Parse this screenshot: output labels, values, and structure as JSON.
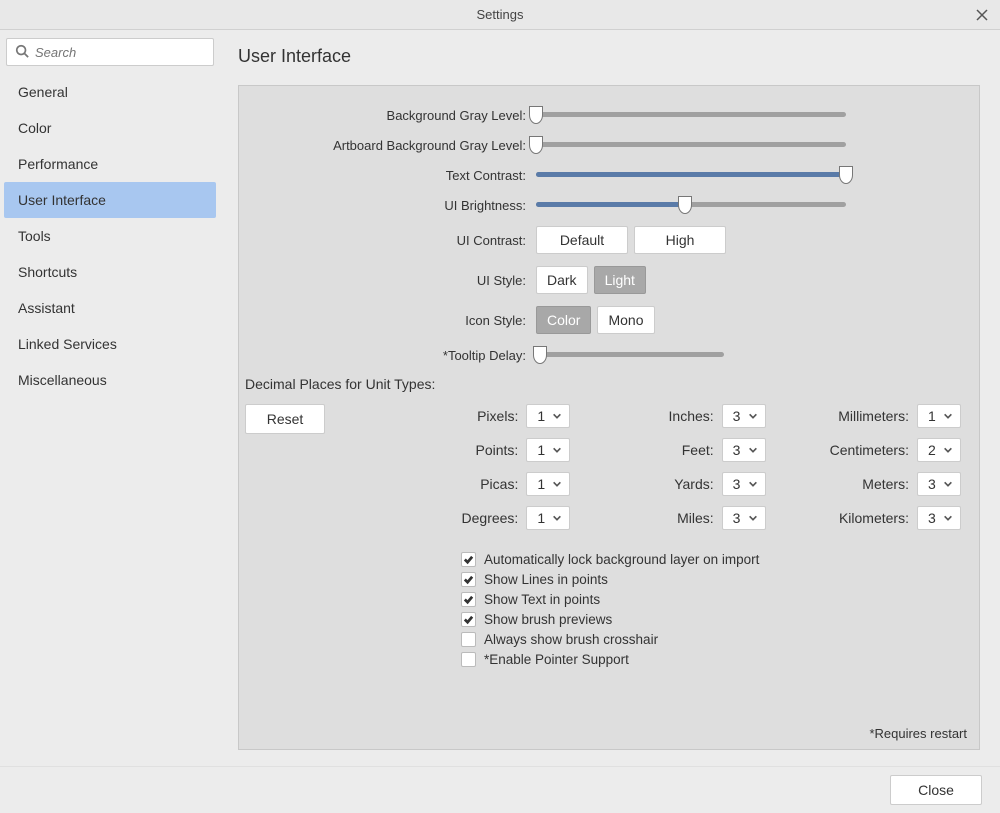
{
  "titlebar": {
    "title": "Settings"
  },
  "search": {
    "placeholder": "Search"
  },
  "sidebar": {
    "items": [
      {
        "label": "General"
      },
      {
        "label": "Color"
      },
      {
        "label": "Performance"
      },
      {
        "label": "User Interface"
      },
      {
        "label": "Tools"
      },
      {
        "label": "Shortcuts"
      },
      {
        "label": "Assistant"
      },
      {
        "label": "Linked Services"
      },
      {
        "label": "Miscellaneous"
      }
    ],
    "active_index": 3
  },
  "content": {
    "title": "User Interface",
    "sliders": {
      "bg_gray": {
        "label": "Background Gray Level:",
        "value_pct": 0
      },
      "artboard_bg_gray": {
        "label": "Artboard Background Gray Level:",
        "value_pct": 0
      },
      "text_contrast": {
        "label": "Text Contrast:",
        "value_pct": 100
      },
      "ui_brightness": {
        "label": "UI Brightness:",
        "value_pct": 48
      },
      "tooltip_delay": {
        "label": "*Tooltip Delay:",
        "value_pct": 2
      }
    },
    "ui_contrast": {
      "label": "UI Contrast:",
      "options": [
        "Default",
        "High"
      ],
      "selected_index": 0
    },
    "ui_style": {
      "label": "UI Style:",
      "options": [
        "Dark",
        "Light"
      ],
      "selected_index": 1
    },
    "icon_style": {
      "label": "Icon Style:",
      "options": [
        "Color",
        "Mono"
      ],
      "selected_index": 0
    },
    "decimal_section": "Decimal Places for Unit Types:",
    "reset": "Reset",
    "units": {
      "pixels": {
        "label": "Pixels:",
        "value": "1"
      },
      "points": {
        "label": "Points:",
        "value": "1"
      },
      "picas": {
        "label": "Picas:",
        "value": "1"
      },
      "degrees": {
        "label": "Degrees:",
        "value": "1"
      },
      "inches": {
        "label": "Inches:",
        "value": "3"
      },
      "feet": {
        "label": "Feet:",
        "value": "3"
      },
      "yards": {
        "label": "Yards:",
        "value": "3"
      },
      "miles": {
        "label": "Miles:",
        "value": "3"
      },
      "millimeters": {
        "label": "Millimeters:",
        "value": "1"
      },
      "centimeters": {
        "label": "Centimeters:",
        "value": "2"
      },
      "meters": {
        "label": "Meters:",
        "value": "3"
      },
      "kilometers": {
        "label": "Kilometers:",
        "value": "3"
      }
    },
    "checks": [
      {
        "label": "Automatically lock background layer on import",
        "checked": true
      },
      {
        "label": "Show Lines in points",
        "checked": true
      },
      {
        "label": "Show Text in points",
        "checked": true
      },
      {
        "label": "Show brush previews",
        "checked": true
      },
      {
        "label": "Always show brush crosshair",
        "checked": false
      },
      {
        "label": "*Enable Pointer Support",
        "checked": false
      }
    ],
    "restart_note": "*Requires restart"
  },
  "footer": {
    "close": "Close"
  }
}
